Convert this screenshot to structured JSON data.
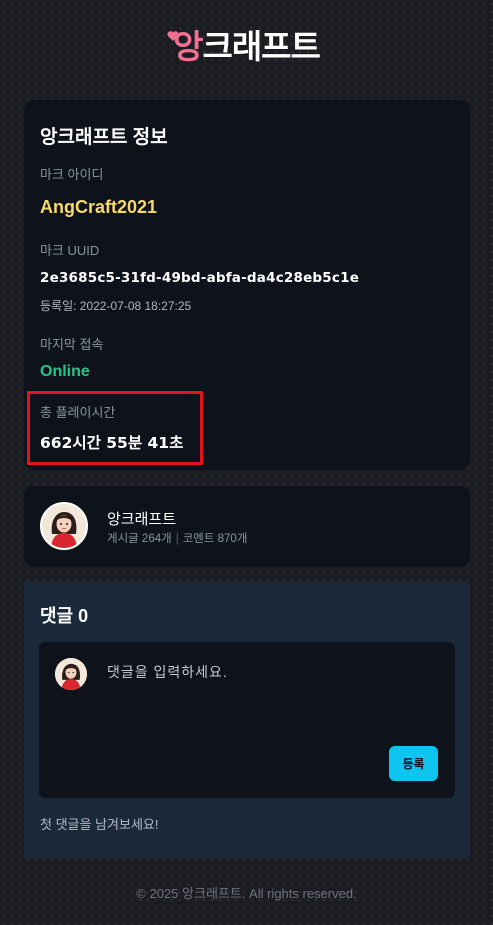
{
  "logo": {
    "accent": "앙",
    "rest": "크래프트"
  },
  "info": {
    "title": "앙크래프트 정보",
    "id_label": "마크 아이디",
    "id_value": "AngCraft2021",
    "uuid_label": "마크 UUID",
    "uuid_value": "2e3685c5-31fd-49bd-abfa-da4c28eb5c1e",
    "registered": "등록일: 2022-07-08 18:27:25",
    "last_seen_label": "마지막 접속",
    "last_seen_value": "Online",
    "playtime_label": "총 플레이시간",
    "playtime_value": "662시간 55분 41초"
  },
  "profile": {
    "name": "앙크래프트",
    "posts": "게시글 264개",
    "comments": "코멘트 870개"
  },
  "comments": {
    "title": "댓글 0",
    "placeholder": "댓글을 입력하세요.",
    "submit_label": "등록",
    "empty_text": "첫 댓글을 남겨보세요!"
  },
  "footer": {
    "text": "© 2025 앙크래프트. All rights reserved."
  },
  "colors": {
    "accent_pink": "#f2708f",
    "id_yellow": "#f8d86a",
    "online_green": "#22c58b",
    "highlight_red": "#e1141c",
    "button_cyan": "#0ec5ef"
  },
  "icons": [
    "heart-icon",
    "avatar-image"
  ]
}
